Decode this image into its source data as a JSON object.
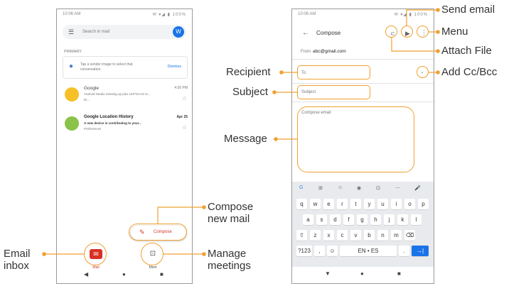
{
  "colors": {
    "accent": "#f0a030",
    "mail_red": "#d93025",
    "keyboard_bg": "#e8eaed",
    "send_blue": "#1a73e8"
  },
  "left_phone": {
    "status_time": "10:06 AM",
    "status_icons": "✉ ▾◢ ▮ 100%",
    "search_placeholder": "Search in mail",
    "avatar_letter": "W",
    "section": "PRIMARY",
    "tip_text": "Tap a sender image to select that conversation.",
    "tip_action": "Dismiss",
    "emails": [
      {
        "sender": "Google",
        "time": "4:30 PM",
        "subject": "Android Studio meeting up plus UHTSAAS to...",
        "preview": "Dr..."
      },
      {
        "sender": "Google Location History",
        "time": "Apr 25",
        "subject": "A new device is contributing to your...",
        "preview": "Preferences"
      }
    ],
    "compose_label": "Compose",
    "nav": [
      {
        "label": "Mail",
        "icon": "mail-icon"
      },
      {
        "label": "Meet",
        "icon": "video-icon"
      }
    ],
    "system_nav": [
      "◀",
      "●",
      "■"
    ]
  },
  "right_phone": {
    "status_time": "10:06 AM",
    "status_icons": "✉ ▾◢ ▮ 100%",
    "title": "Compose",
    "from_label": "From",
    "from_value": "abc@gmail.com",
    "to_placeholder": "To",
    "subject_placeholder": "Subject",
    "body_placeholder": "Compose email",
    "keyboard": {
      "suggestions": [
        "G",
        "⊞",
        "☺",
        "◉",
        "⊡",
        "⋯",
        "🎤"
      ],
      "row1": [
        "q",
        "w",
        "e",
        "r",
        "t",
        "y",
        "u",
        "i",
        "o",
        "p"
      ],
      "row2": [
        "a",
        "s",
        "d",
        "f",
        "g",
        "h",
        "j",
        "k",
        "l"
      ],
      "row3": [
        "⇧",
        "z",
        "x",
        "c",
        "v",
        "b",
        "n",
        "m",
        "⌫"
      ],
      "row4": [
        "?123",
        ",",
        "☺",
        "EN • ES",
        ".",
        "→|"
      ]
    },
    "system_nav": [
      "▼",
      "●",
      "■"
    ]
  },
  "callouts": {
    "email_inbox": "Email inbox",
    "compose_new_mail": "Compose new mail",
    "manage_meetings": "Manage meetings",
    "recipient": "Recipient",
    "subject": "Subject",
    "message": "Message",
    "send_email": "Send email",
    "menu": "Menu",
    "attach_file": "Attach File",
    "add_cc_bcc": "Add Cc/Bcc"
  }
}
